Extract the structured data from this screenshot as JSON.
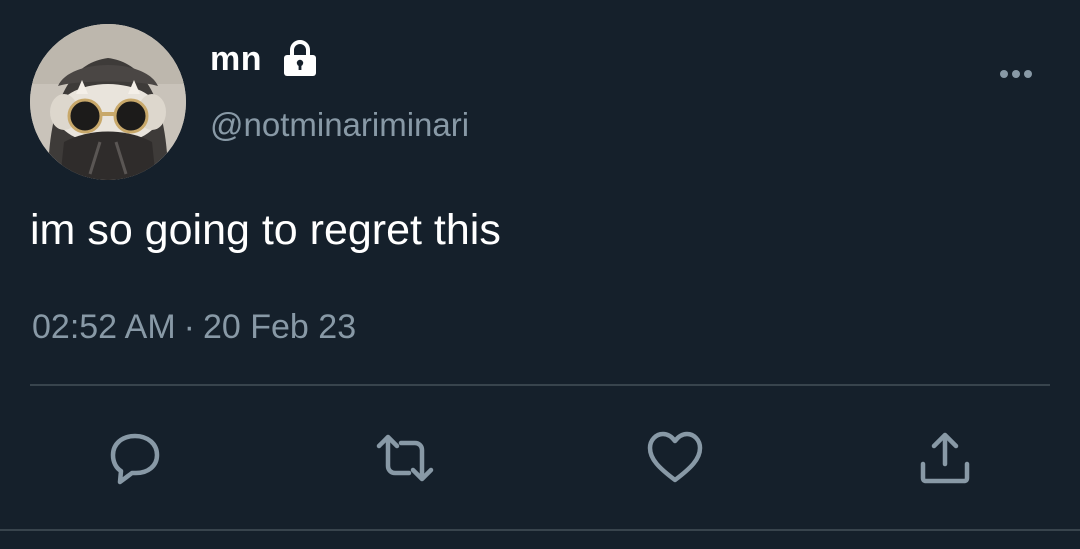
{
  "user": {
    "display_name": "mn",
    "handle": "@notminariminari",
    "protected_icon": "lock-icon",
    "avatar": "profile-avatar"
  },
  "tweet": {
    "text": "im so going to regret this",
    "time": "02:52 AM",
    "separator": "·",
    "date": "20 Feb 23"
  },
  "actions": {
    "reply": "reply-icon",
    "retweet": "retweet-icon",
    "like": "heart-icon",
    "share": "share-icon"
  },
  "colors": {
    "background": "#15202b",
    "primary_text": "#ffffff",
    "secondary_text": "#8899a6",
    "divider": "#38444d"
  }
}
